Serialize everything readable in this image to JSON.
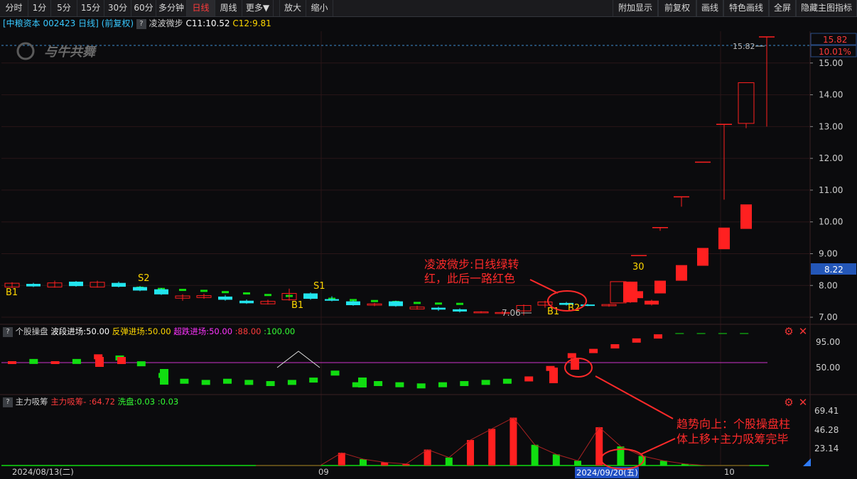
{
  "toolbar": {
    "left": [
      "分时",
      "1分",
      "5分",
      "15分",
      "30分",
      "60分",
      "多分钟",
      "日线",
      "周线",
      "更多▼",
      "放大",
      "缩小"
    ],
    "active": "日线",
    "right": [
      "附加显示",
      "前复权",
      "画线",
      "特色画线",
      "全屏",
      "隐藏主图指标"
    ]
  },
  "info": {
    "stock": "[中粮资本 002423 日线]",
    "adjust": "(前复权)",
    "q": "?",
    "indicator": "凌波微步",
    "c11": "C11:10.52",
    "c12": "C12:9.81"
  },
  "watermark": "与牛共舞",
  "price_axis": {
    "ticks": [
      "15.00",
      "14.00",
      "13.00",
      "12.00",
      "11.00",
      "10.00",
      "9.00",
      "8.00",
      "7.00"
    ],
    "top_price": "15.82",
    "top_pct": "10.01%",
    "current": "8.22"
  },
  "main_chart": {
    "high_label": "15.82",
    "low_label": "7.06",
    "signals": [
      "B1",
      "S2",
      "S1",
      "B1",
      "B1",
      "B2",
      "30"
    ],
    "annotation": [
      "凌波微步:日线绿转",
      "红，此后一路红色"
    ]
  },
  "panel2": {
    "q": "?",
    "title": "个股操盘",
    "items": [
      {
        "text": "波段进场:50.00",
        "color": "#ffffff"
      },
      {
        "text": "反弹进场:50.00",
        "color": "#ffd700"
      },
      {
        "text": "超跌进场:50.00",
        "color": "#ff33ff"
      },
      {
        "text": ":88.00",
        "color": "#ff3b3b"
      },
      {
        "text": ":100.00",
        "color": "#33ff33"
      }
    ],
    "axis": [
      "95.00",
      "50.00"
    ]
  },
  "panel3": {
    "q": "?",
    "title": "主力吸筹",
    "items": [
      {
        "text": "主力吸筹-",
        "color": "#ff3b3b"
      },
      {
        "text": ":64.72",
        "color": "#ff3b3b"
      },
      {
        "text": "洗盘:0.03",
        "color": "#33ff33"
      },
      {
        "text": ":0.03",
        "color": "#33ff33"
      }
    ],
    "axis": [
      "69.41",
      "46.28",
      "23.14"
    ],
    "annotation": [
      "趋势向上：个股操盘柱",
      "体上移+主力吸筹完毕"
    ]
  },
  "date_axis": {
    "start": "2024/08/13(二)",
    "m9": "09",
    "sel": "2024/09/20(五)",
    "m10": "10"
  },
  "colors": {
    "up": "#ff2020",
    "down": "#22e5ee",
    "green": "#11dd11",
    "grid": "#2a1618",
    "annotation": "#ff2a2a"
  },
  "chart_data": {
    "type": "candlestick",
    "price_ylim": [
      6.8,
      16.0
    ],
    "candles": [
      {
        "o": 7.95,
        "c": 8.07,
        "h": 8.1,
        "l": 7.92,
        "up": true
      },
      {
        "o": 8.05,
        "c": 7.97,
        "h": 8.08,
        "l": 7.95,
        "up": false
      },
      {
        "o": 7.95,
        "c": 8.08,
        "h": 8.15,
        "l": 7.93,
        "up": true
      },
      {
        "o": 8.12,
        "c": 7.98,
        "h": 8.14,
        "l": 7.96,
        "up": false
      },
      {
        "o": 7.95,
        "c": 8.1,
        "h": 8.15,
        "l": 7.93,
        "up": true
      },
      {
        "o": 8.08,
        "c": 7.96,
        "h": 8.12,
        "l": 7.94,
        "up": false
      },
      {
        "o": 7.95,
        "c": 7.84,
        "h": 7.98,
        "l": 7.82,
        "up": false
      },
      {
        "o": 7.88,
        "c": 7.72,
        "h": 7.92,
        "l": 7.7,
        "up": false
      },
      {
        "o": 7.6,
        "c": 7.67,
        "h": 7.72,
        "l": 7.52,
        "up": true
      },
      {
        "o": 7.62,
        "c": 7.68,
        "h": 7.74,
        "l": 7.58,
        "up": true
      },
      {
        "o": 7.65,
        "c": 7.55,
        "h": 7.7,
        "l": 7.52,
        "up": false
      },
      {
        "o": 7.52,
        "c": 7.44,
        "h": 7.56,
        "l": 7.42,
        "up": false
      },
      {
        "o": 7.42,
        "c": 7.5,
        "h": 7.55,
        "l": 7.4,
        "up": true
      },
      {
        "o": 7.55,
        "c": 7.75,
        "h": 7.9,
        "l": 7.52,
        "up": true
      },
      {
        "o": 7.75,
        "c": 7.58,
        "h": 7.78,
        "l": 7.55,
        "up": false
      },
      {
        "o": 7.57,
        "c": 7.52,
        "h": 7.66,
        "l": 7.5,
        "up": false
      },
      {
        "o": 7.5,
        "c": 7.38,
        "h": 7.53,
        "l": 7.36,
        "up": false
      },
      {
        "o": 7.38,
        "c": 7.42,
        "h": 7.45,
        "l": 7.35,
        "up": true
      },
      {
        "o": 7.5,
        "c": 7.35,
        "h": 7.52,
        "l": 7.33,
        "up": false
      },
      {
        "o": 7.26,
        "c": 7.32,
        "h": 7.36,
        "l": 7.24,
        "up": true
      },
      {
        "o": 7.3,
        "c": 7.24,
        "h": 7.33,
        "l": 7.2,
        "up": false
      },
      {
        "o": 7.25,
        "c": 7.18,
        "h": 7.28,
        "l": 7.15,
        "up": false
      },
      {
        "o": 7.15,
        "c": 7.17,
        "h": 7.19,
        "l": 7.13,
        "up": true
      },
      {
        "o": 7.12,
        "c": 7.15,
        "h": 7.2,
        "l": 7.1,
        "up": true
      },
      {
        "o": 7.2,
        "c": 7.37,
        "h": 7.4,
        "l": 7.06,
        "up": true
      },
      {
        "o": 7.38,
        "c": 7.48,
        "h": 7.52,
        "l": 7.3,
        "up": true
      },
      {
        "o": 7.45,
        "c": 7.39,
        "h": 7.48,
        "l": 7.37,
        "up": false
      },
      {
        "o": 7.4,
        "c": 7.38,
        "h": 7.42,
        "l": 7.35,
        "up": false
      },
      {
        "o": 7.36,
        "c": 7.4,
        "h": 7.42,
        "l": 7.33,
        "up": true
      },
      {
        "o": 7.47,
        "c": 8.12,
        "h": 8.12,
        "l": 7.45,
        "up": true
      },
      {
        "o": 7.4,
        "c": 7.52,
        "h": 7.55,
        "l": 7.37,
        "up": true
      },
      {
        "o": 7.6,
        "c": 7.82,
        "h": 7.85,
        "l": 7.55,
        "up": true
      },
      {
        "o": 7.75,
        "c": 8.15,
        "h": 8.2,
        "l": 7.72,
        "up": true
      },
      {
        "o": 8.15,
        "c": 8.64,
        "h": 8.64,
        "l": 8.12,
        "up": true
      },
      {
        "o": 8.62,
        "c": 9.18,
        "h": 9.2,
        "l": 8.6,
        "up": true
      },
      {
        "o": 9.14,
        "c": 9.82,
        "h": 9.84,
        "l": 9.12,
        "up": true
      },
      {
        "o": 9.78,
        "c": 10.55,
        "h": 10.58,
        "l": 9.75,
        "up": true
      }
    ],
    "special": [
      {
        "idx": 32,
        "type": "flat",
        "price": 8.94
      },
      {
        "idx": 33,
        "type": "flat",
        "price": 9.82
      },
      {
        "idx": 34,
        "type": "flat",
        "price": 10.79
      },
      {
        "idx": 35,
        "type": "flat",
        "price": 11.88
      },
      {
        "idx": 36,
        "type": "flat",
        "price": 13.07
      },
      {
        "idx": 37,
        "type": "hollow",
        "o": 13.1,
        "c": 14.38,
        "h": 14.38,
        "l": 12.95
      },
      {
        "idx": 38,
        "type": "flat",
        "price": 15.82
      }
    ],
    "green_dash": [
      8.15,
      8.12,
      8.1,
      8.05,
      8.0,
      7.95,
      7.93,
      7.89,
      7.86,
      7.83,
      7.79,
      7.75,
      7.7,
      7.67,
      7.62,
      7.58,
      7.54,
      7.51,
      7.48,
      7.45,
      7.43,
      7.42
    ],
    "panel2_values": [
      50,
      52,
      50,
      52,
      60,
      58,
      48,
      28,
      18,
      16,
      18,
      16,
      14,
      16,
      20,
      32,
      12,
      14,
      12,
      10,
      12,
      14,
      16,
      18,
      22,
      40,
      62,
      70,
      78,
      88,
      95,
      100,
      100,
      100,
      100
    ],
    "panel3_values": [
      0,
      0,
      0,
      0,
      0,
      0,
      0,
      0,
      0,
      0,
      0,
      0,
      0,
      0,
      0,
      16,
      8,
      4,
      2,
      20,
      10,
      32,
      46,
      60,
      26,
      14,
      6,
      48,
      24,
      12,
      6,
      2,
      0,
      0,
      0
    ],
    "panel3_ylim": [
      0,
      69.41
    ]
  }
}
